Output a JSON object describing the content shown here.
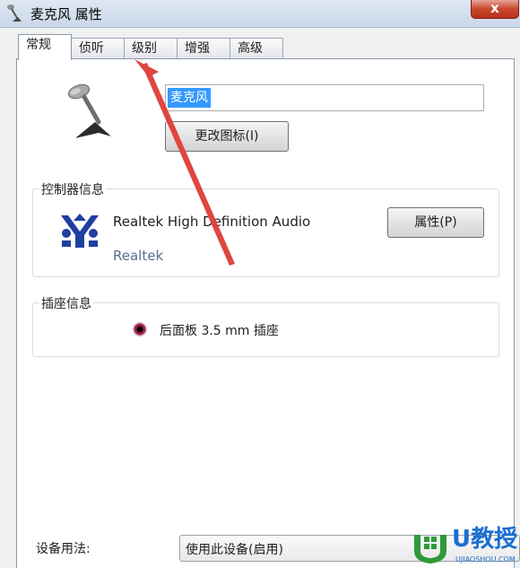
{
  "window": {
    "title": "麦克风 属性",
    "close_label": "x"
  },
  "tabs": [
    {
      "label": "常规",
      "active": true
    },
    {
      "label": "侦听",
      "active": false
    },
    {
      "label": "级别",
      "active": false
    },
    {
      "label": "增强",
      "active": false
    },
    {
      "label": "高级",
      "active": false
    }
  ],
  "general": {
    "device_name_value": "麦克风",
    "change_icon_label": "更改图标(I)"
  },
  "controller": {
    "section_title": "控制器信息",
    "device_name": "Realtek High Definition Audio",
    "vendor": "Realtek",
    "properties_label": "属性(P)"
  },
  "jack": {
    "section_title": "插座信息",
    "jack_text": "后面板 3.5 mm 插座"
  },
  "usage": {
    "label": "设备用法:",
    "selected_option": "使用此设备(启用)"
  },
  "watermark": {
    "title": "U教授",
    "subtitle": "UJIAOSHOU.COM"
  },
  "colors": {
    "annotation_arrow": "#e0463f",
    "selection": "#3399ff",
    "watermark": "#1a6fd0"
  }
}
